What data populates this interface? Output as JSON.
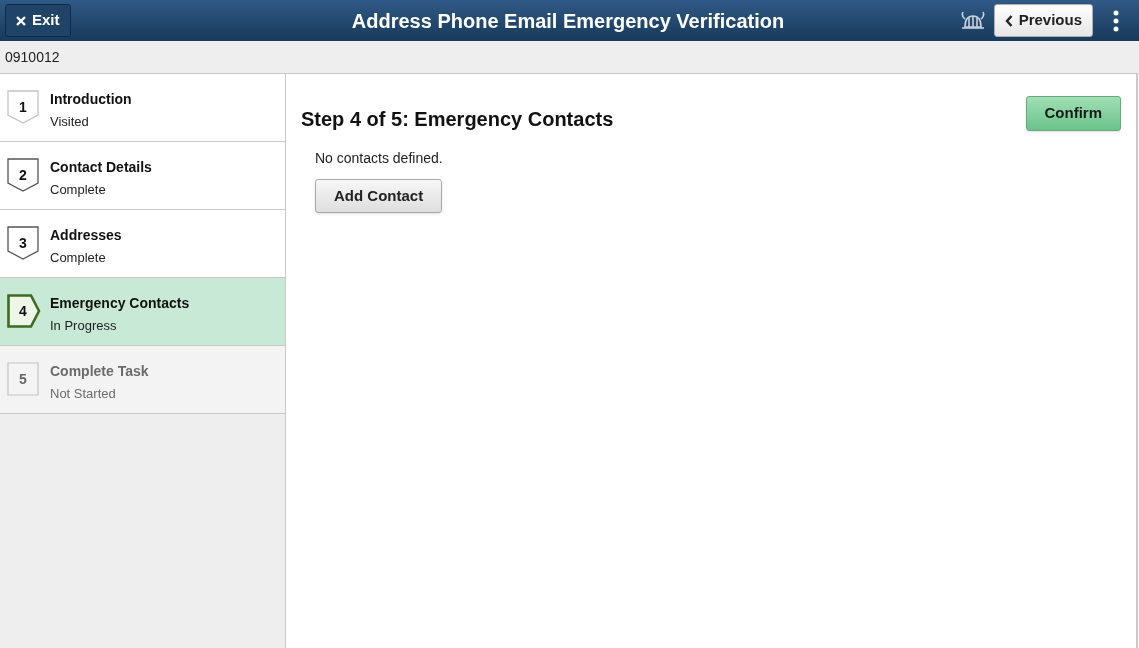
{
  "header": {
    "exit_button": "Exit",
    "title": "Address Phone Email Emergency Verification",
    "previous_button": "Previous"
  },
  "employee_id": "0910012",
  "steps": [
    {
      "number": "1",
      "title": "Introduction",
      "status": "Visited",
      "kind": "visited",
      "selected": false
    },
    {
      "number": "2",
      "title": "Contact Details",
      "status": "Complete",
      "kind": "complete",
      "selected": false
    },
    {
      "number": "3",
      "title": "Addresses",
      "status": "Complete",
      "kind": "complete",
      "selected": false
    },
    {
      "number": "4",
      "title": "Emergency Contacts",
      "status": "In Progress",
      "kind": "current",
      "selected": true
    },
    {
      "number": "5",
      "title": "Complete Task",
      "status": "Not Started",
      "kind": "not_started",
      "selected": false
    }
  ],
  "content": {
    "heading": "Step 4 of 5: Emergency Contacts",
    "confirm_button": "Confirm",
    "message": "No contacts defined.",
    "add_button": "Add Contact"
  }
}
